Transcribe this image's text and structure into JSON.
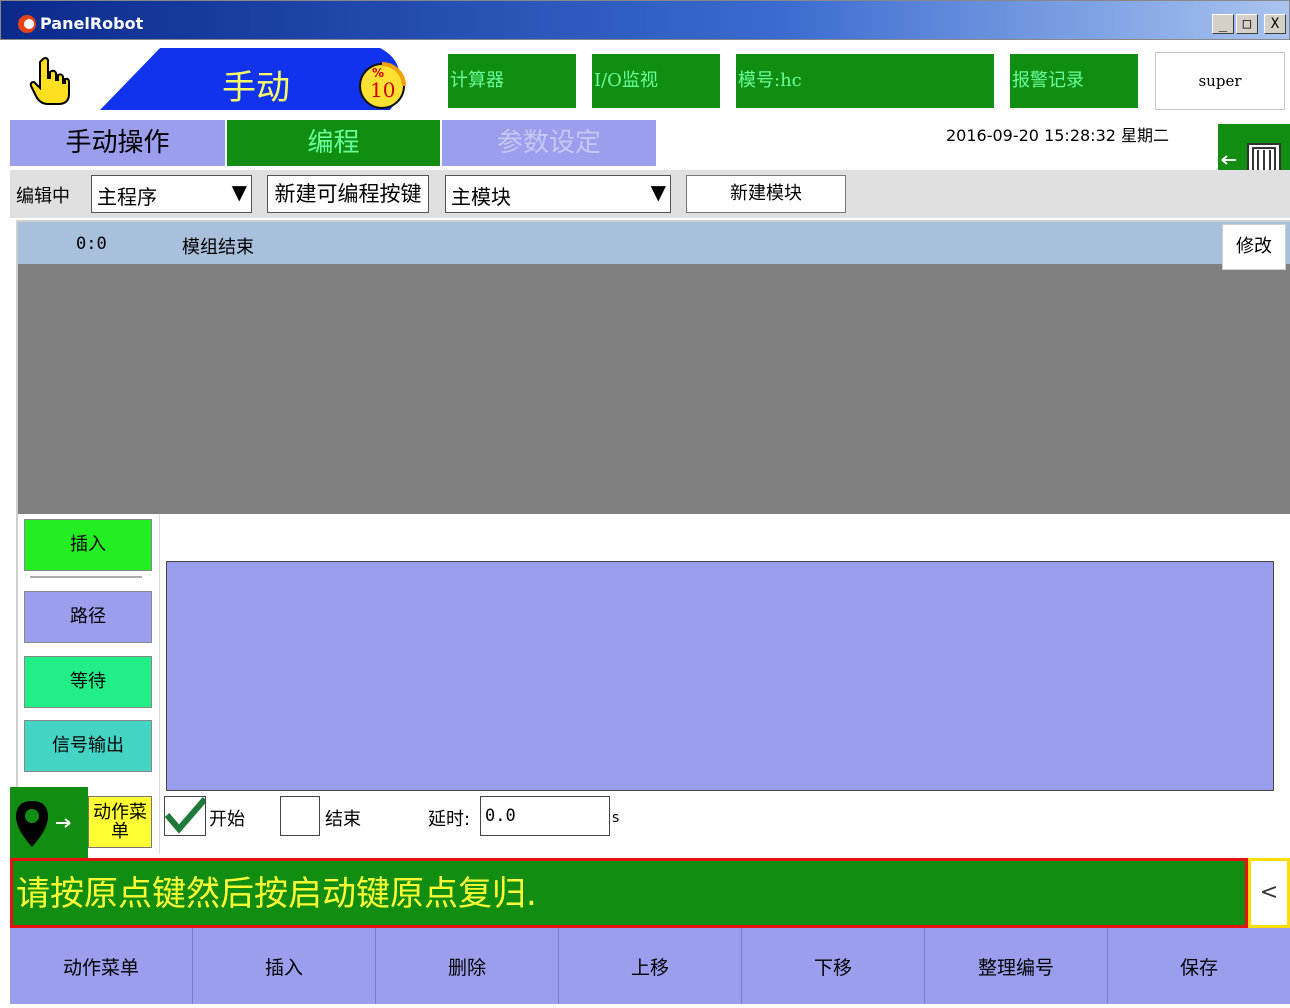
{
  "window": {
    "title": "PanelRobot",
    "min": "_",
    "max": "□",
    "close": "X"
  },
  "header": {
    "mode": "手动",
    "speed_label": "%",
    "speed_value": "10",
    "buttons": [
      "计算器",
      "I/O监视",
      "模号:hc",
      "报警记录"
    ],
    "user": "super"
  },
  "tabs": [
    {
      "label": "手动操作",
      "state": "normal"
    },
    {
      "label": "编程",
      "state": "active"
    },
    {
      "label": "参数设定",
      "state": "disabled"
    }
  ],
  "datetime": "2016-09-20  15:28:32  星期二",
  "toolbar": {
    "editing_label": "编辑中",
    "program_select": "主程序",
    "new_key_button": "新建可编程按键",
    "module_select": "主模块",
    "new_module_button": "新建模块"
  },
  "program_list": {
    "rows": [
      {
        "index": "0:0",
        "text": "模组结束"
      }
    ],
    "modify_button": "修改"
  },
  "side_buttons": {
    "insert": "插入",
    "path": "路径",
    "wait": "等待",
    "signal_output": "信号输出",
    "action_menu": "动作菜单"
  },
  "options": {
    "start_label": "开始",
    "start_checked": true,
    "end_label": "结束",
    "end_checked": false,
    "delay_label": "延时:",
    "delay_value": "0.0",
    "delay_unit": "s"
  },
  "message": "请按原点键然后按启动键原点复归.",
  "message_toggle": "<",
  "commands": [
    "动作菜单",
    "插入",
    "删除",
    "上移",
    "下移",
    "整理编号",
    "保存"
  ],
  "colors": {
    "green": "#118d11",
    "lavender": "#9b9ded",
    "message_text": "#ffff33",
    "message_border": "#e81010"
  }
}
